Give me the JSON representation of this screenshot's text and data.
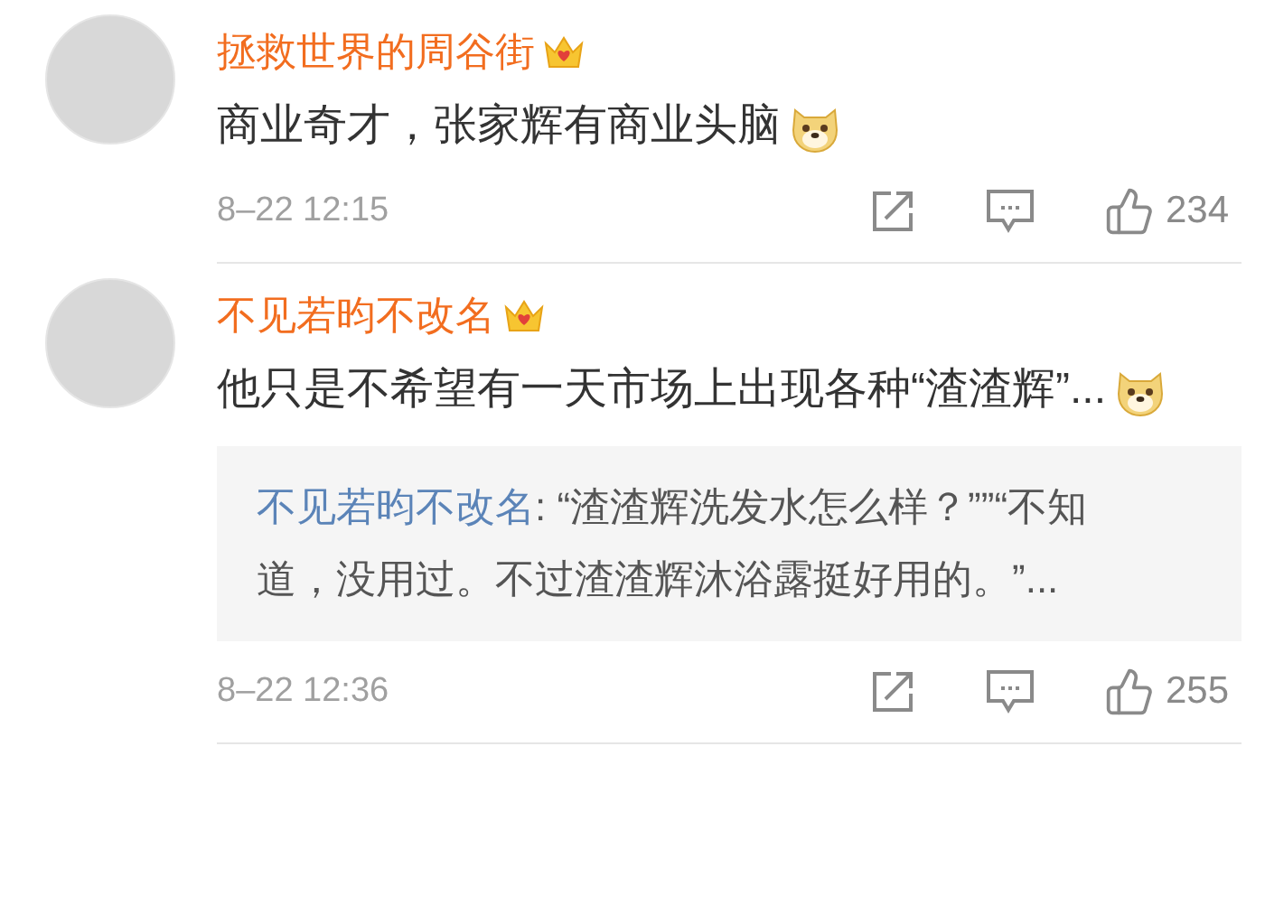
{
  "comments": [
    {
      "username": "拯救世界的周谷街",
      "text": "商业奇才，张家辉有商业头脑",
      "time": "8–22 12:15",
      "likes": "234"
    },
    {
      "username": "不见若昀不改名",
      "text": "他只是不希望有一天市场上出现各种“渣渣辉”...",
      "quote": {
        "author": "不见若昀不改名",
        "text": ": “渣渣辉洗发水怎么样？””“不知道，没用过。不过渣渣辉沐浴露挺好用的。”..."
      },
      "time": "8–22 12:36",
      "likes": "255"
    }
  ]
}
